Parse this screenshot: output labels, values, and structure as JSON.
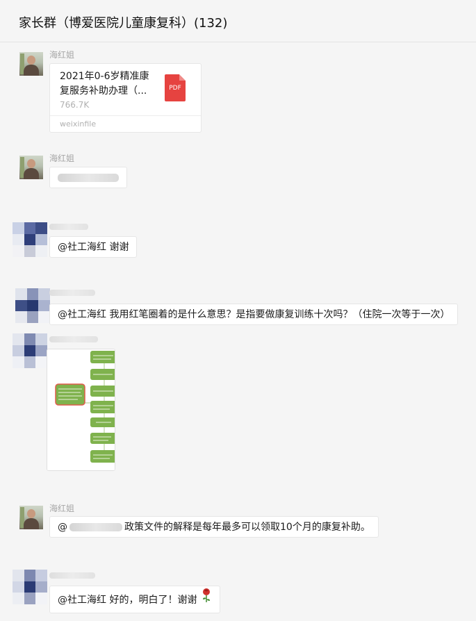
{
  "window": {
    "title": "家长群（博爱医院儿童康复科）(132)"
  },
  "messages": [
    {
      "sender": "海红姐",
      "type": "file",
      "file": {
        "name": "2021年0-6岁精准康复服务补助办理（...",
        "size": "766.7K",
        "source": "weixinfile",
        "icon": "pdf-icon",
        "icon_label": "PDF"
      }
    },
    {
      "sender": "海红姐",
      "type": "text",
      "text_visible": ""
    },
    {
      "sender": "",
      "type": "text",
      "text": "@社工海红 谢谢"
    },
    {
      "sender": "",
      "type": "text",
      "text": "@社工海红 我用红笔圈着的是什么意思？是指要做康复训练十次吗？（住院一次等于一次）"
    },
    {
      "sender": "",
      "type": "image",
      "image_desc": "flowchart-thumbnail"
    },
    {
      "sender": "海红姐",
      "type": "text",
      "prefix": "@",
      "text": "政策文件的解释是每年最多可以领取10个月的康复补助。"
    },
    {
      "sender": "",
      "type": "text",
      "text": "@社工海红 好的，明白了！谢谢",
      "emoji": "rose-icon"
    }
  ],
  "colors": {
    "background": "#f5f5f5",
    "bubble": "#ffffff",
    "pdf": "#e64340",
    "flow_green": "#7fb24d",
    "flow_highlight": "#e15b4b"
  }
}
